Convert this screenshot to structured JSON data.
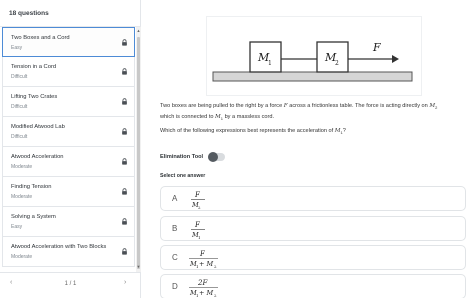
{
  "sidebar": {
    "header": "18 questions",
    "items": [
      {
        "title": "Two Boxes and a Cord",
        "difficulty": "Easy",
        "locked": true,
        "active": true
      },
      {
        "title": "Tension in a Cord",
        "difficulty": "Difficult",
        "locked": true
      },
      {
        "title": "Lifting Two Crates",
        "difficulty": "Difficult",
        "locked": true
      },
      {
        "title": "Modified Atwood Lab",
        "difficulty": "Difficult",
        "locked": true
      },
      {
        "title": "Atwood Acceleration",
        "difficulty": "Moderate",
        "locked": true
      },
      {
        "title": "Finding Tension",
        "difficulty": "Moderate",
        "locked": true
      },
      {
        "title": "Solving a System",
        "difficulty": "Easy",
        "locked": true
      },
      {
        "title": "Atwood Acceleration with Two Blocks",
        "difficulty": "Moderate",
        "locked": true
      }
    ],
    "pager": {
      "text": "1 / 1",
      "prev": "‹",
      "next": "›"
    }
  },
  "figure": {
    "box1_label": "M",
    "box1_sub": "1",
    "box2_label": "M",
    "box2_sub": "2",
    "force_label": "F"
  },
  "question": {
    "text_1": "Two boxes are being pulled to the right by a force ",
    "force_symbol": "F",
    "text_2": " across a frictionless table. The force is acting directly on ",
    "m2_symbol": "M",
    "m2_sub": "2",
    "text_3": "which is connected to ",
    "m1_symbol": "M",
    "m1_sub": "1",
    "text_4": " by a massless cord.",
    "prompt_1": "Which of the following expressions best represents the acceleration of ",
    "prompt_symbol": "M",
    "prompt_sub": "1",
    "prompt_2": "?"
  },
  "elimination_tool": {
    "label": "Elimination Tool",
    "enabled": false
  },
  "select_label": "Select one answer",
  "answers": [
    {
      "letter": "A",
      "numerator": "F",
      "denominator": "M",
      "den_sub": "2"
    },
    {
      "letter": "B",
      "numerator": "F",
      "denominator": "M",
      "den_sub": "1"
    },
    {
      "letter": "C",
      "numerator": "F",
      "denominator": "M",
      "den_sub": "1",
      "den_plus": " + M",
      "den_plus_sub": "2"
    },
    {
      "letter": "D",
      "numerator": "2F",
      "denominator": "M",
      "den_sub": "1",
      "den_plus": " + M",
      "den_plus_sub": "2"
    }
  ],
  "colors": {
    "active_border": "#4d8bd6",
    "lock": "#4a4f55",
    "toggle_knob": "#555b61"
  }
}
